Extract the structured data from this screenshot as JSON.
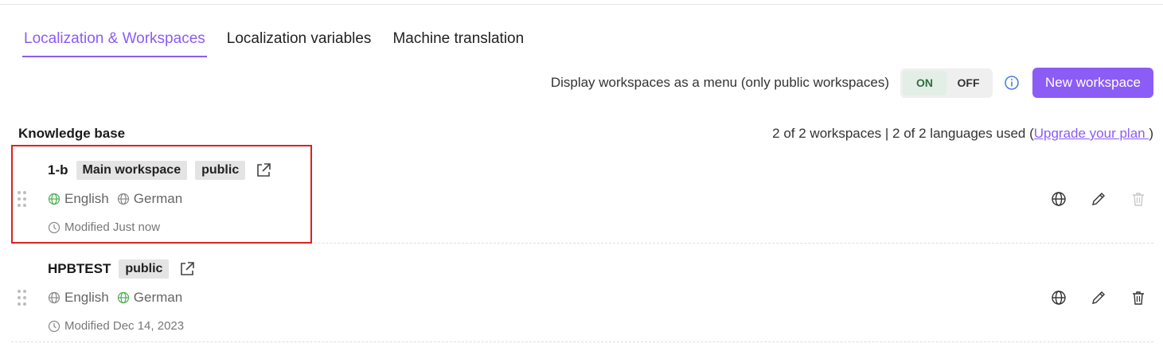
{
  "tabs": [
    {
      "label": "Localization & Workspaces",
      "active": true
    },
    {
      "label": "Localization variables",
      "active": false
    },
    {
      "label": "Machine translation",
      "active": false
    }
  ],
  "toolbar": {
    "menu_label": "Display workspaces as a menu (only public workspaces)",
    "toggle_on": "ON",
    "toggle_off": "OFF",
    "toggle_selected": "ON",
    "info_icon": "info-icon",
    "new_workspace_label": "New workspace"
  },
  "section": {
    "title": "Knowledge base",
    "usage_text": "2 of 2 workspaces | 2 of 2 languages used (",
    "upgrade_link": "Upgrade your plan ",
    "usage_close": ")"
  },
  "workspaces": [
    {
      "name": "1-b",
      "badges": [
        "Main workspace",
        "public"
      ],
      "languages": [
        {
          "name": "English",
          "icon": "globe-icon",
          "color": "#4caf50"
        },
        {
          "name": "German",
          "icon": "globe-icon",
          "color": "#888888"
        }
      ],
      "modified": "Modified Just now",
      "delete_disabled": true
    },
    {
      "name": "HPBTEST",
      "badges": [
        "public"
      ],
      "languages": [
        {
          "name": "English",
          "icon": "globe-icon",
          "color": "#888888"
        },
        {
          "name": "German",
          "icon": "globe-icon",
          "color": "#4caf50"
        }
      ],
      "modified": "Modified Dec 14, 2023",
      "delete_disabled": false
    }
  ],
  "colors": {
    "accent": "#8b5cf6",
    "highlight": "#e02020",
    "toggle_on_bg": "#e3efe6"
  }
}
